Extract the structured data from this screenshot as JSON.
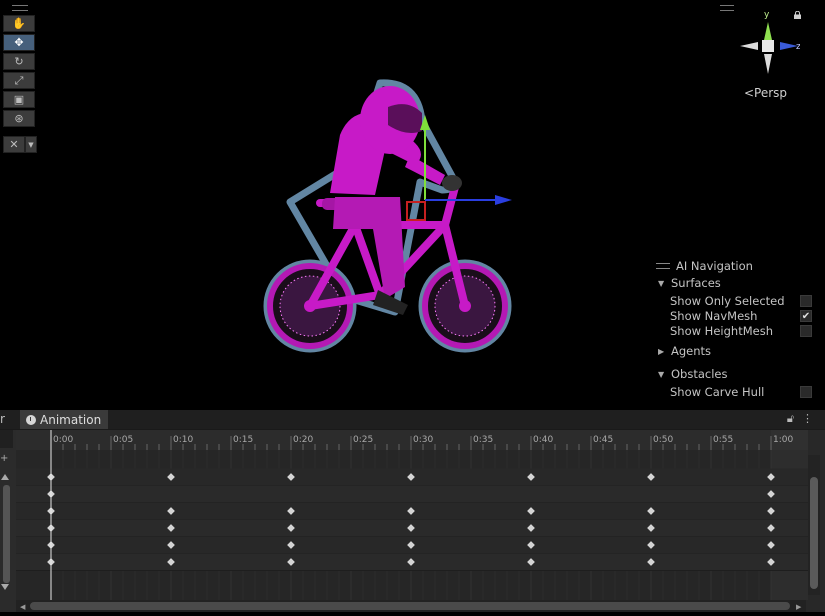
{
  "scene": {
    "toolbar": [
      {
        "name": "hand-tool-button",
        "glyph": "✋",
        "active": false
      },
      {
        "name": "move-tool-button",
        "glyph": "✥",
        "active": true
      },
      {
        "name": "rotate-tool-button",
        "glyph": "↻",
        "active": false
      },
      {
        "name": "scale-tool-button",
        "glyph": "⤢",
        "active": false
      },
      {
        "name": "rect-tool-button",
        "glyph": "▣",
        "active": false
      },
      {
        "name": "transform-tool-button",
        "glyph": "⊛",
        "active": false
      }
    ],
    "custom_tool_glyph": "✕",
    "custom_tool_arrow": "▼",
    "gizmo": {
      "y_label": "y",
      "z_label": "z",
      "projection_label": "<Persp"
    },
    "colors": {
      "rider": "#c71ac7",
      "outline": "#6d95b5",
      "y_axis": "#7fe03a",
      "x_axis": "#2a3ee0",
      "pivot": "#c62020"
    }
  },
  "nav_panel": {
    "title": "AI Navigation",
    "surfaces_label": "Surfaces",
    "show_only_selected": "Show Only Selected",
    "show_navmesh": "Show NavMesh",
    "show_heightmesh": "Show HeightMesh",
    "agents_label": "Agents",
    "obstacles_label": "Obstacles",
    "show_carve_hull": "Show Carve Hull",
    "checks": {
      "show_only_selected": false,
      "show_navmesh": true,
      "show_heightmesh": false,
      "show_carve_hull": false
    }
  },
  "animation": {
    "prev_tab_fragment": "r",
    "tab_label": "Animation",
    "ruler_labels": [
      "0:00",
      "0:05",
      "0:10",
      "0:15",
      "0:20",
      "0:25",
      "0:30",
      "0:35",
      "0:40",
      "0:45",
      "0:50",
      "0:55",
      "1:00"
    ],
    "keyframe_rows": [
      [
        0,
        10,
        20,
        30,
        40,
        50,
        60
      ],
      [
        0,
        60
      ],
      [
        0,
        10,
        20,
        30,
        40,
        50,
        60
      ],
      [
        0,
        10,
        20,
        30,
        40,
        50,
        60
      ],
      [
        0,
        10,
        20,
        30,
        40,
        50,
        60
      ],
      [
        0,
        10,
        20,
        30,
        40,
        50,
        60
      ]
    ]
  }
}
